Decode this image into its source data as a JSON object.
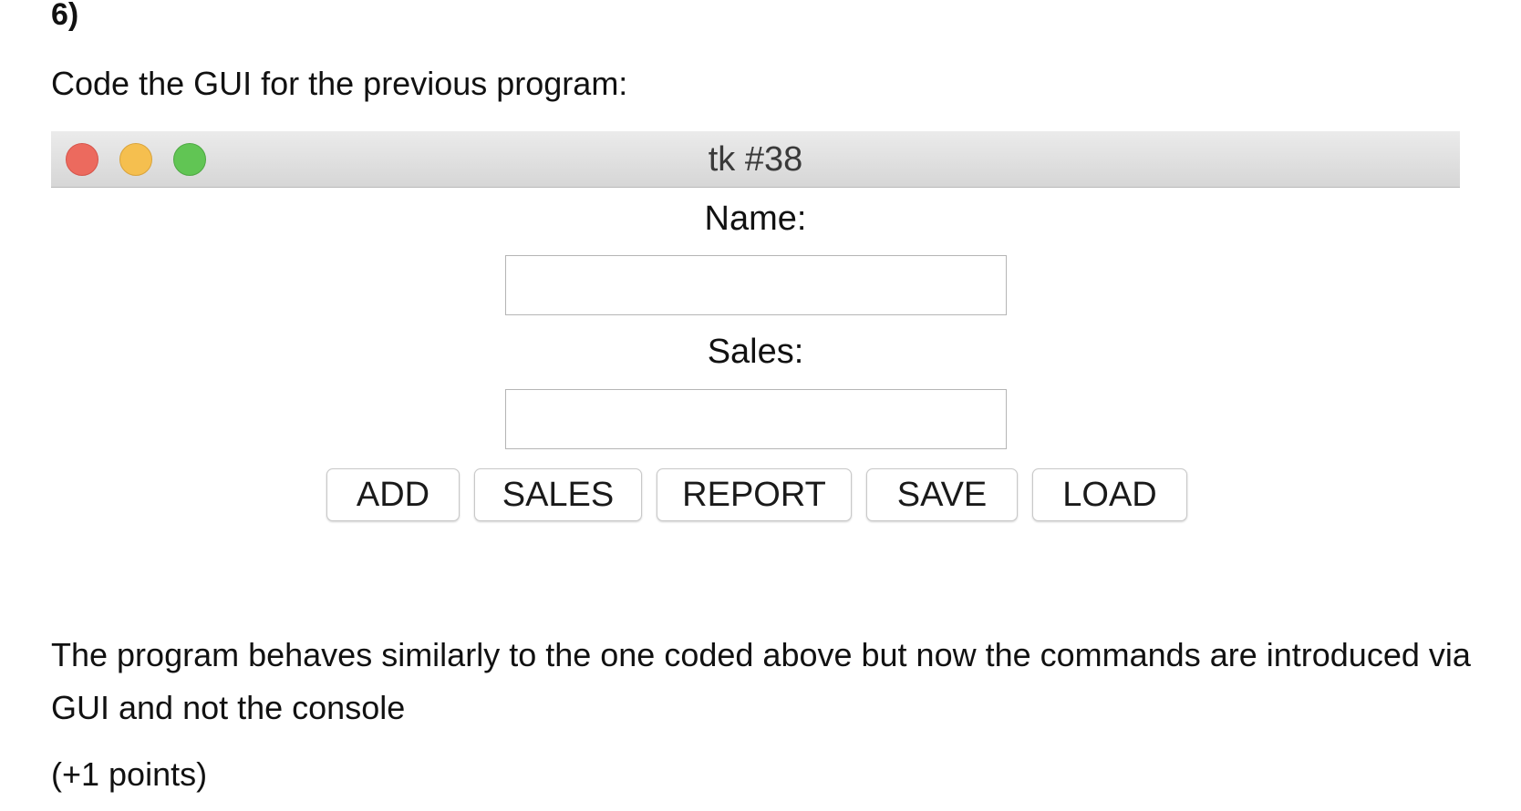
{
  "question": {
    "number": "6)",
    "intro": "Code the GUI for the previous program:",
    "description": "The program behaves similarly to the one coded above but now the commands are introduced via GUI and not the console",
    "points": "(+1 points)"
  },
  "window": {
    "title": "tk #38",
    "traffic_lights": {
      "close_color": "#ec6a5e",
      "minimize_color": "#f5bf4f",
      "zoom_color": "#61c554"
    },
    "name_label": "Name:",
    "name_value": "",
    "sales_label": "Sales:",
    "sales_value": "",
    "buttons": {
      "add": "ADD",
      "sales": "SALES",
      "report": "REPORT",
      "save": "SAVE",
      "load": "LOAD"
    }
  }
}
